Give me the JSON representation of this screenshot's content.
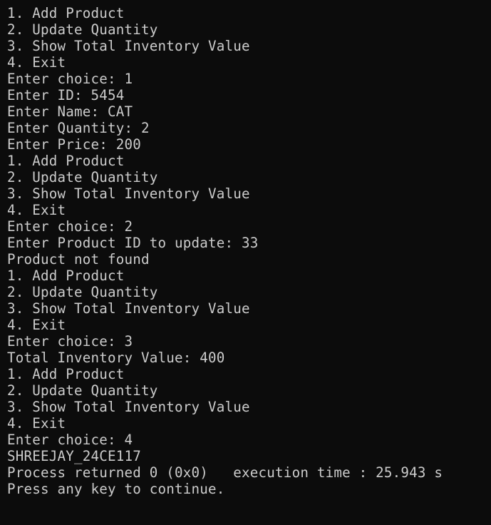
{
  "console": {
    "lines": [
      "1. Add Product",
      "2. Update Quantity",
      "3. Show Total Inventory Value",
      "4. Exit",
      "Enter choice: 1",
      "Enter ID: 5454",
      "Enter Name: CAT",
      "Enter Quantity: 2",
      "Enter Price: 200",
      "1. Add Product",
      "2. Update Quantity",
      "3. Show Total Inventory Value",
      "4. Exit",
      "Enter choice: 2",
      "Enter Product ID to update: 33",
      "Product not found",
      "1. Add Product",
      "2. Update Quantity",
      "3. Show Total Inventory Value",
      "4. Exit",
      "Enter choice: 3",
      "Total Inventory Value: 400",
      "1. Add Product",
      "2. Update Quantity",
      "3. Show Total Inventory Value",
      "4. Exit",
      "Enter choice: 4",
      "SHREEJAY_24CE117",
      "Process returned 0 (0x0)   execution time : 25.943 s",
      "Press any key to continue."
    ]
  },
  "colors": {
    "background": "#0c0c0c",
    "text": "#cccccc"
  }
}
